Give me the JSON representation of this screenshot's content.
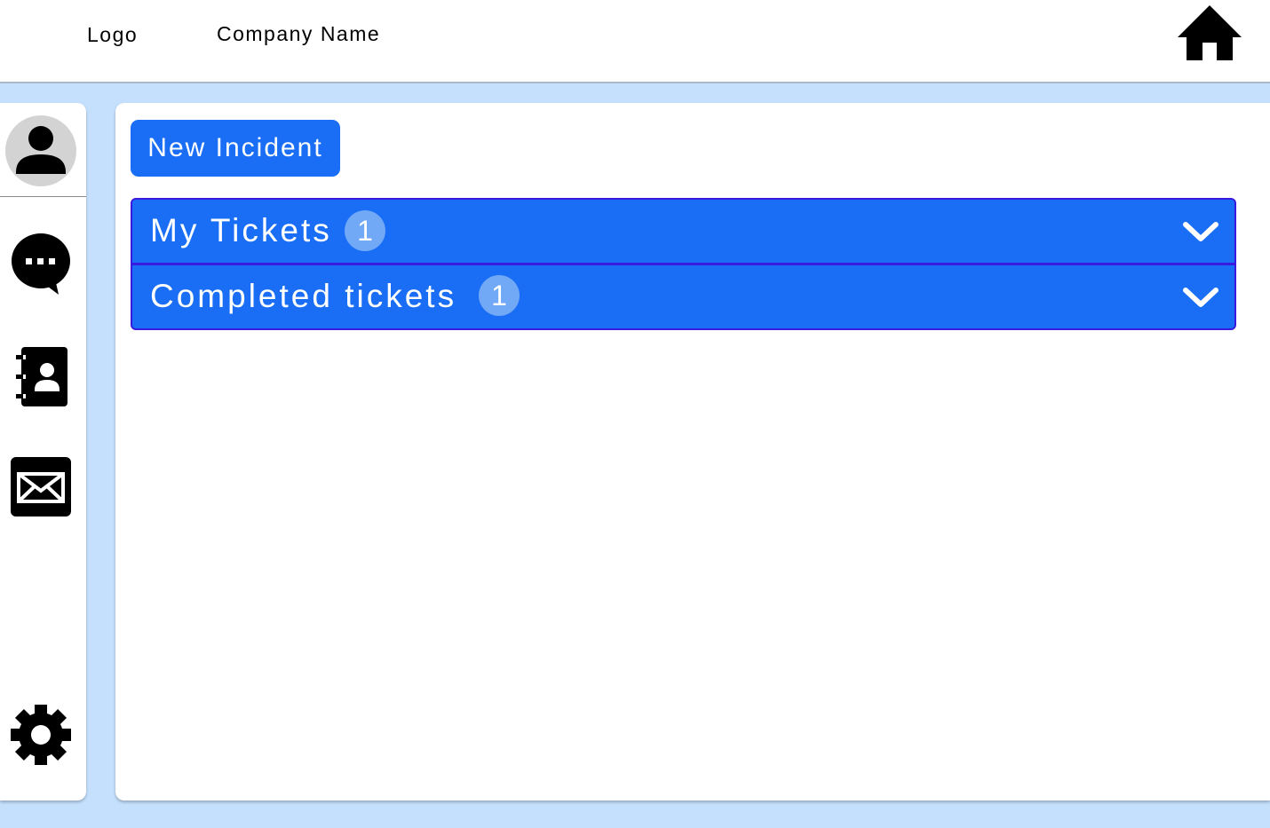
{
  "header": {
    "logo": "Logo",
    "company_name": "Company Name",
    "home_icon": "home-icon"
  },
  "sidebar": {
    "avatar_icon": "user-avatar-icon",
    "items": [
      {
        "icon": "chat-bubble-icon"
      },
      {
        "icon": "contacts-book-icon"
      },
      {
        "icon": "mail-icon"
      }
    ],
    "settings_icon": "gear-icon"
  },
  "main": {
    "new_incident_label": "New Incident",
    "accordion": [
      {
        "label": "My Tickets",
        "count": "1"
      },
      {
        "label": "Completed tickets",
        "count": "1"
      }
    ]
  },
  "colors": {
    "page_background": "#c5e0fd",
    "primary_blue": "#1a6ef5",
    "accordion_border": "#3a1ae0",
    "badge_background": "#72a9f6"
  }
}
